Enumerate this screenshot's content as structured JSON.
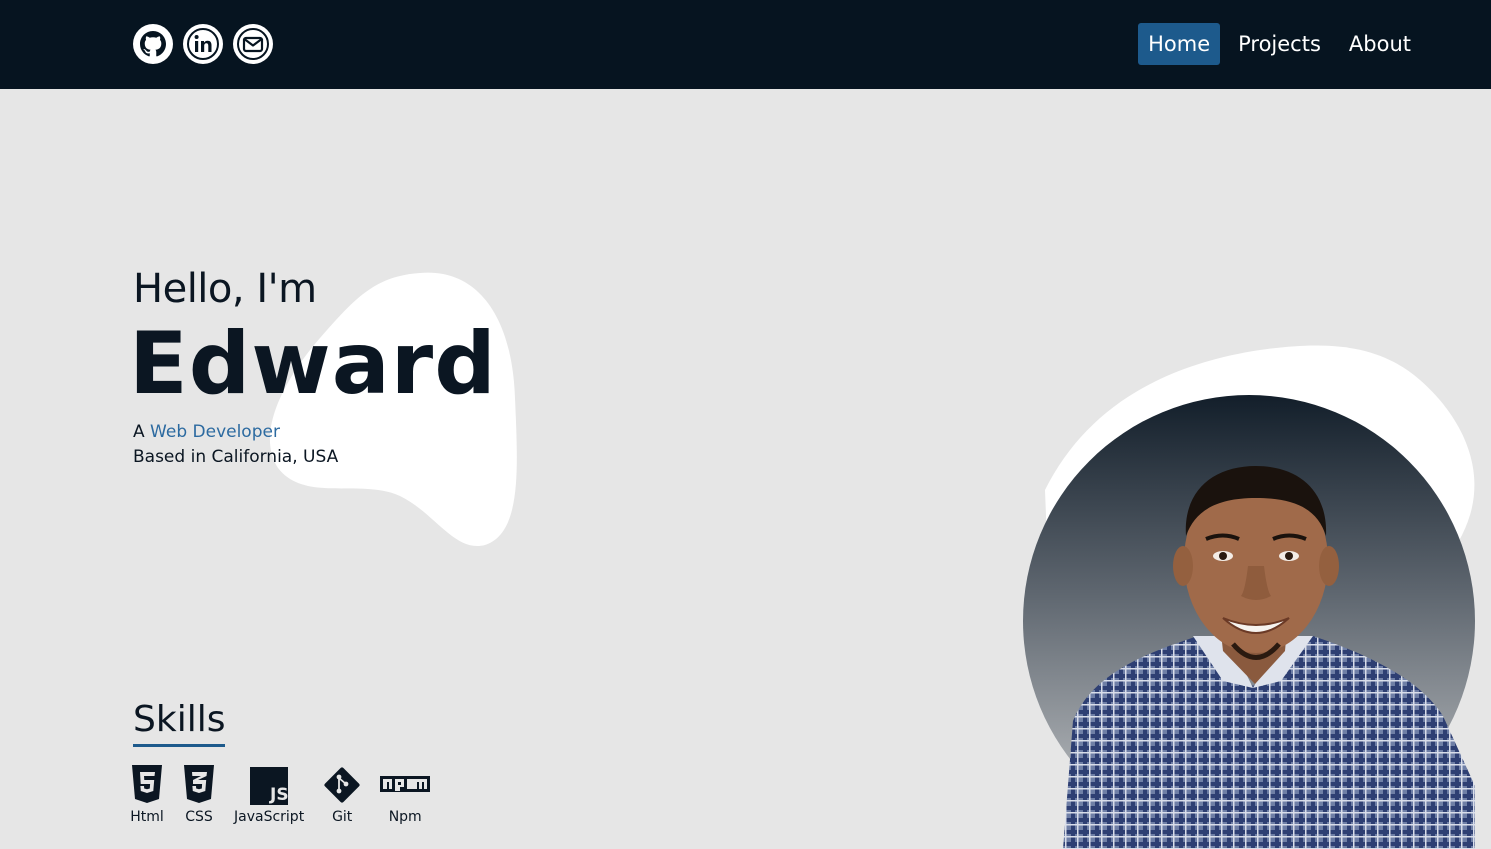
{
  "header": {
    "social": [
      {
        "icon": "github-icon"
      },
      {
        "icon": "linkedin-icon"
      },
      {
        "icon": "mail-icon"
      }
    ],
    "nav": [
      {
        "label": "Home",
        "active": true
      },
      {
        "label": "Projects",
        "active": false
      },
      {
        "label": "About",
        "active": false
      }
    ]
  },
  "hero": {
    "greeting": "Hello, I'm",
    "name": "Edward",
    "role_prefix": "A",
    "role_highlight": "Web Developer",
    "location": "Based in California, USA"
  },
  "skills": {
    "title": "Skills",
    "items": [
      {
        "label": "Html",
        "icon": "html5-icon"
      },
      {
        "label": "CSS",
        "icon": "css3-icon"
      },
      {
        "label": "JavaScript",
        "icon": "javascript-icon"
      },
      {
        "label": "Git",
        "icon": "git-icon"
      },
      {
        "label": "Npm",
        "icon": "npm-icon"
      }
    ]
  },
  "colors": {
    "header_bg": "#061420",
    "page_bg": "#e6e6e6",
    "accent": "#1d5a8c",
    "highlight_text": "#2c6aa0",
    "text_dark": "#0b1622"
  }
}
